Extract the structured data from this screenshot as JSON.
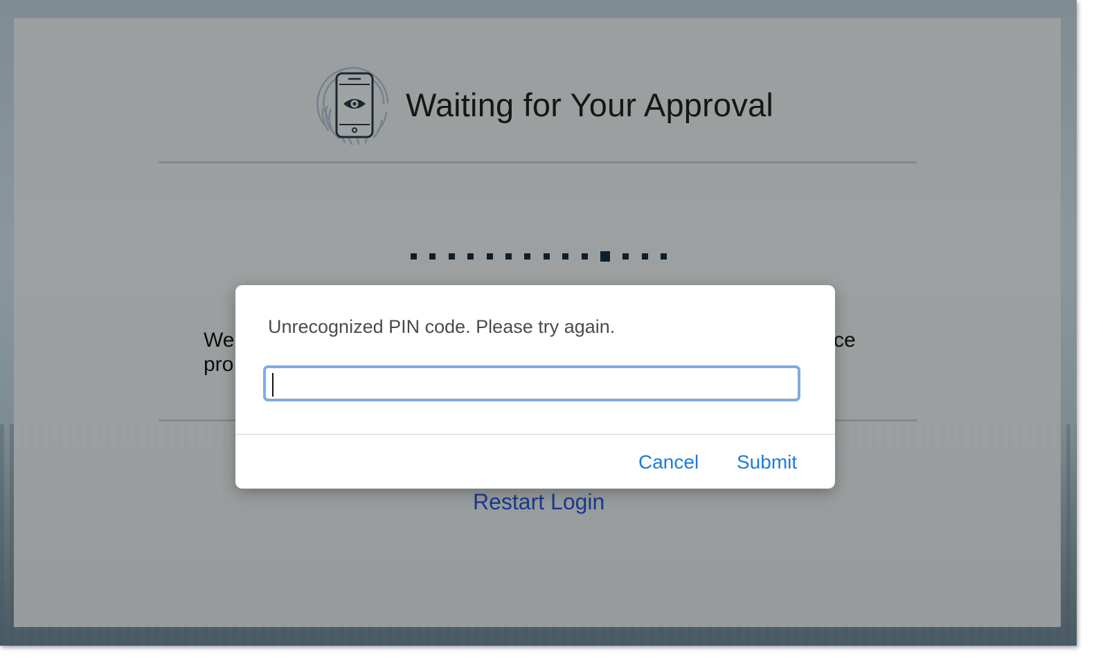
{
  "page": {
    "title": "Waiting for Your Approval",
    "body_text_start": "We",
    "body_text_line2_start": "pro",
    "body_text_end": "ce",
    "restart_link": "Restart Login",
    "progress": {
      "total_dots": 14,
      "active_index": 10
    }
  },
  "dialog": {
    "message": "Unrecognized PIN code. Please try again.",
    "pin_value": "",
    "cancel_label": "Cancel",
    "submit_label": "Submit"
  },
  "colors": {
    "link": "#1a3a8f",
    "dialog_button": "#1a7be0",
    "focus_ring": "#7fa9ec",
    "progress_dot": "#0d1f2c"
  },
  "icons": {
    "app_icon": "fingerprint-phone-eye-icon"
  }
}
